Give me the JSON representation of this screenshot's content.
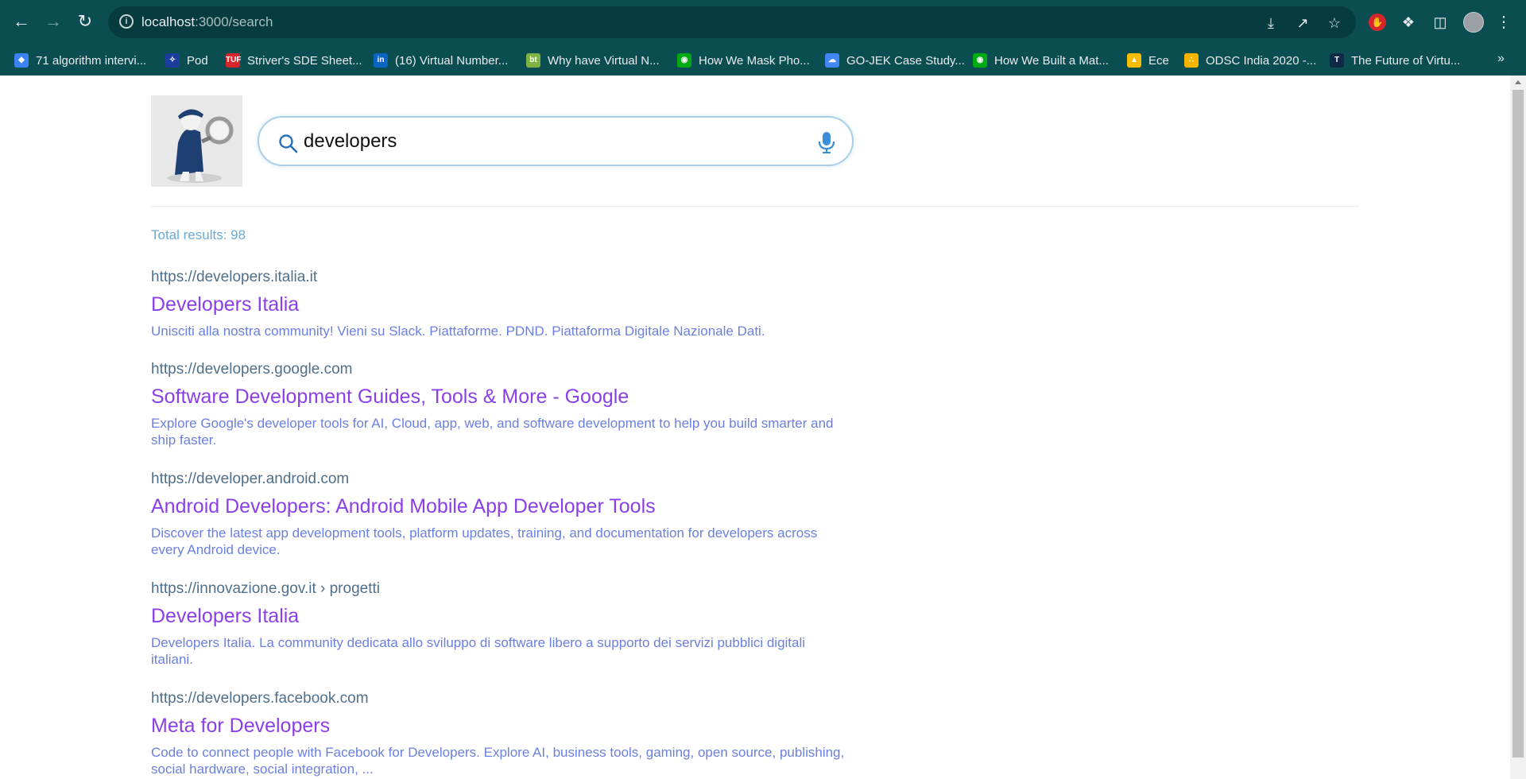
{
  "browser": {
    "url_host": "localhost",
    "url_rest": ":3000/search",
    "bookmarks": [
      {
        "label": "71 algorithm intervi...",
        "icon": "diamond-icon",
        "color": "#3b82f6"
      },
      {
        "label": "Pod",
        "icon": "pod-icon",
        "color": "#1a3d9e"
      },
      {
        "label": "Striver's SDE Sheet...",
        "icon": "tuf-icon",
        "color": "#d7262b"
      },
      {
        "label": "(16) Virtual Number...",
        "icon": "linkedin-icon",
        "color": "#0a66c2"
      },
      {
        "label": "Why have Virtual N...",
        "icon": "bt-icon",
        "color": "#7cb342"
      },
      {
        "label": "How We Mask Pho...",
        "icon": "gojek-icon",
        "color": "#00aa13"
      },
      {
        "label": "GO-JEK Case Study...",
        "icon": "cloud-icon",
        "color": "#4285f4"
      },
      {
        "label": "How We Built a Mat...",
        "icon": "gojek-icon",
        "color": "#00aa13"
      },
      {
        "label": "Ece",
        "icon": "drive-icon",
        "color": "#fbbc04"
      },
      {
        "label": "ODSC India 2020 -...",
        "icon": "odsc-icon",
        "color": "#f4b400"
      },
      {
        "label": "The Future of Virtu...",
        "icon": "t-icon",
        "color": "#0e2a47"
      }
    ]
  },
  "search": {
    "query": "developers"
  },
  "results_summary": "Total results: 98",
  "results": [
    {
      "url": "https://developers.italia.it",
      "title": "Developers Italia",
      "description": "Unisciti alla nostra community! Vieni su Slack. Piattaforme. PDND. Piattaforma Digitale Nazionale Dati."
    },
    {
      "url": "https://developers.google.com",
      "title": "Software Development Guides, Tools & More - Google",
      "description": "Explore Google's developer tools for AI, Cloud, app, web, and software development to help you build smarter and ship faster."
    },
    {
      "url": "https://developer.android.com",
      "title": "Android Developers: Android Mobile App Developer Tools",
      "description": "Discover the latest app development tools, platform updates, training, and documentation for developers across every Android device."
    },
    {
      "url": "https://innovazione.gov.it › progetti",
      "title": "Developers Italia",
      "description": "Developers Italia. La community dedicata allo sviluppo di software libero a supporto dei servizi pubblici digitali italiani."
    },
    {
      "url": "https://developers.facebook.com",
      "title": "Meta for Developers",
      "description": "Code to connect people with Facebook for Developers. Explore AI, business tools, gaming, open source, publishing, social hardware, social integration, ..."
    }
  ]
}
